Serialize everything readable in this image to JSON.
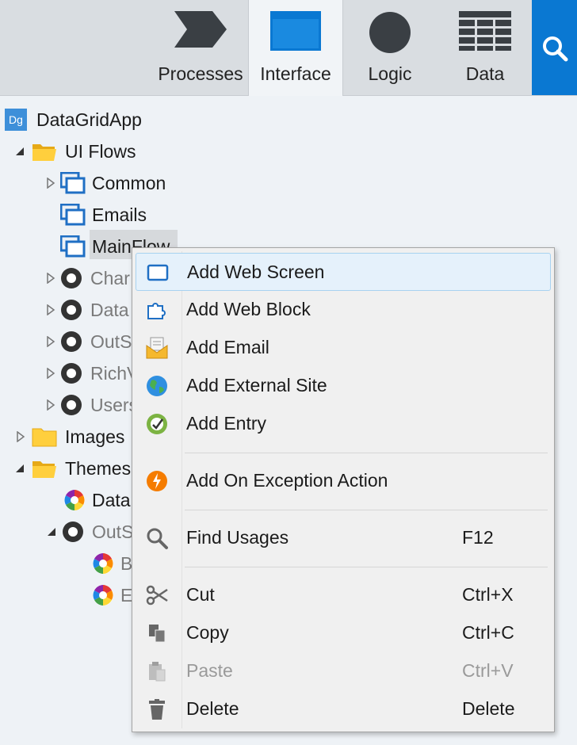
{
  "tabs": [
    {
      "label": "Processes",
      "icon": "process-chevron-icon",
      "active": false
    },
    {
      "label": "Interface",
      "icon": "window-icon",
      "active": true
    },
    {
      "label": "Logic",
      "icon": "circle-icon",
      "active": false
    },
    {
      "label": "Data",
      "icon": "grid-table-icon",
      "active": false
    }
  ],
  "search": {
    "icon": "search-icon"
  },
  "tree": {
    "app": {
      "badge": "Dg",
      "label": "DataGridApp"
    },
    "ui_flows": "UI Flows",
    "common": "Common",
    "emails": "Emails",
    "mainflow": "MainFlow",
    "cha": "Char",
    "data": "Data",
    "outs": "OutS",
    "rich": "RichV",
    "users": "Users",
    "images": "Images",
    "themes": "Themes",
    "theme_data": "Data",
    "theme_outs": "OutS",
    "theme_b": "B",
    "theme_e": "E"
  },
  "menu": {
    "items": [
      {
        "label": "Add Web Screen",
        "key": "",
        "icon": "web-screen-icon"
      },
      {
        "label": "Add Web Block",
        "key": "",
        "icon": "web-block-icon"
      },
      {
        "label": "Add Email",
        "key": "",
        "icon": "email-icon"
      },
      {
        "label": "Add External Site",
        "key": "",
        "icon": "globe-icon"
      },
      {
        "label": "Add Entry",
        "key": "",
        "icon": "entry-icon"
      },
      {
        "label": "Add On Exception Action",
        "key": "",
        "icon": "exception-icon"
      },
      {
        "label": "Find Usages",
        "key": "F12",
        "icon": "magnifier-icon"
      },
      {
        "label": "Cut",
        "key": "Ctrl+X",
        "icon": "scissors-icon"
      },
      {
        "label": "Copy",
        "key": "Ctrl+C",
        "icon": "copy-icon"
      },
      {
        "label": "Paste",
        "key": "Ctrl+V",
        "icon": "paste-icon"
      },
      {
        "label": "Delete",
        "key": "Delete",
        "icon": "trash-icon"
      }
    ]
  },
  "colors": {
    "accent": "#0a78d2",
    "highlight": "#e5f1fb"
  }
}
